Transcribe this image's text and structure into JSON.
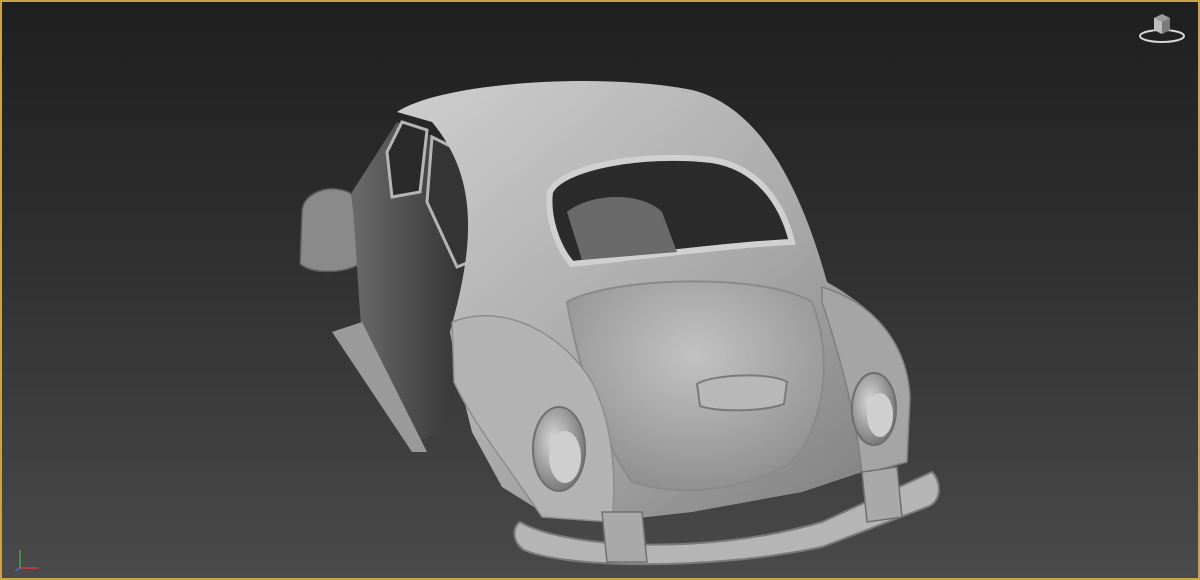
{
  "viewport": {
    "border_color": "#c8a34a",
    "background_top": "#1f1f1f",
    "background_bottom": "#4a4a4a"
  },
  "model": {
    "body_color": "#a9a9a9",
    "body_light": "#c9c9c9",
    "body_dark": "#5a5a5a",
    "interior_color": "#3a3a3a"
  },
  "icons": {
    "viewcube": "viewcube-icon",
    "axis": "axis-tripod-icon"
  }
}
